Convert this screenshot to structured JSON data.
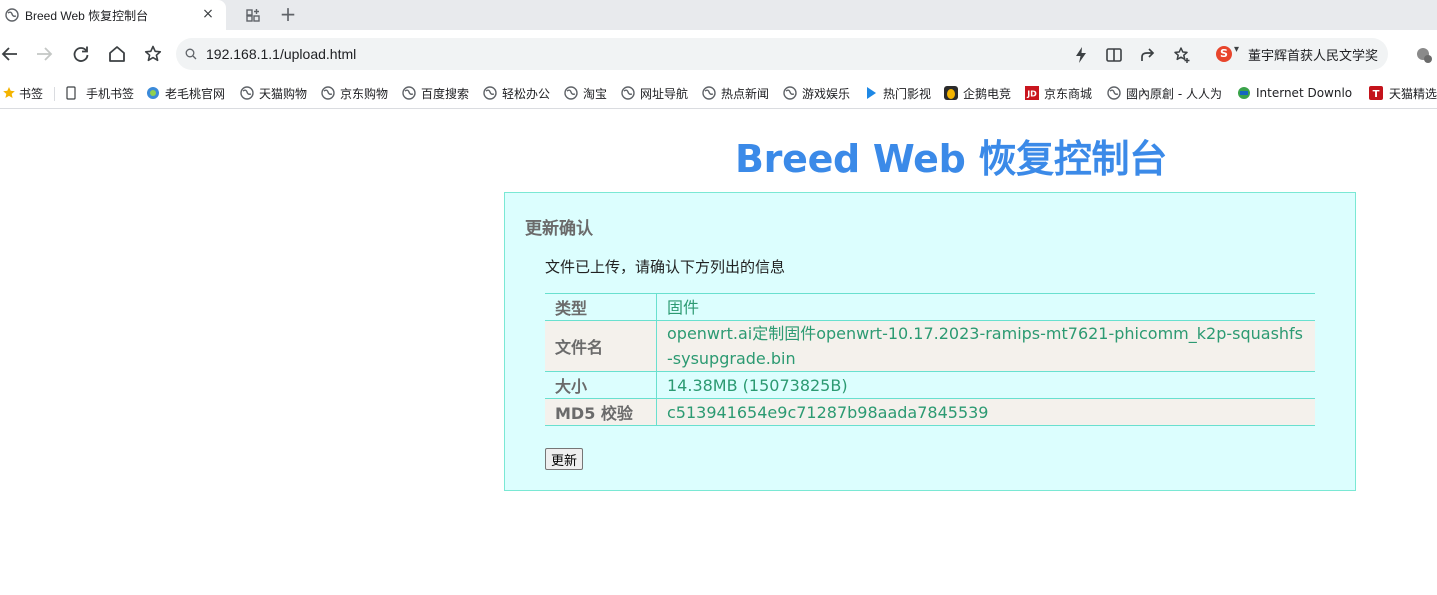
{
  "tab": {
    "title": "Breed Web 恢复控制台",
    "close": "×",
    "new": "+"
  },
  "address": {
    "url": "192.168.1.1/upload.html"
  },
  "extension": {
    "badge": "S",
    "news": "董宇辉首获人民文学奖"
  },
  "bookmarks": [
    {
      "label": "书签",
      "icon": "star-icon"
    },
    {
      "label": "手机书签",
      "icon": "phone-icon"
    },
    {
      "label": "老毛桃官网",
      "icon": "globe-icon"
    },
    {
      "label": "天猫购物",
      "icon": "globe-icon"
    },
    {
      "label": "京东购物",
      "icon": "globe-icon"
    },
    {
      "label": "百度搜索",
      "icon": "globe-icon"
    },
    {
      "label": "轻松办公",
      "icon": "globe-icon"
    },
    {
      "label": "淘宝",
      "icon": "globe-icon"
    },
    {
      "label": "网址导航",
      "icon": "globe-icon"
    },
    {
      "label": "热点新闻",
      "icon": "globe-icon"
    },
    {
      "label": "游戏娱乐",
      "icon": "globe-icon"
    },
    {
      "label": "热门影视",
      "icon": "play-icon"
    },
    {
      "label": "企鹅电竞",
      "icon": "penguin-icon"
    },
    {
      "label": "京东商城",
      "icon": "jd-icon"
    },
    {
      "label": "國內原創 - 人人为",
      "icon": "globe-icon"
    },
    {
      "label": "Internet Downlo",
      "icon": "idm-icon"
    },
    {
      "label": "天猫精选",
      "icon": "tmall-icon"
    }
  ],
  "page": {
    "title": "Breed Web 恢复控制台",
    "heading": "更新确认",
    "description": "文件已上传，请确认下方列出的信息",
    "rows": [
      {
        "key": "类型",
        "value": "固件"
      },
      {
        "key": "文件名",
        "value": "openwrt.ai定制固件openwrt-10.17.2023-ramips-mt7621-phicomm_k2p-squashfs-sysupgrade.bin"
      },
      {
        "key": "大小",
        "value": "14.38MB (15073825B)"
      },
      {
        "key": "MD5 校验",
        "value": "c513941654e9c71287b98aada7845539"
      }
    ],
    "button": "更新"
  },
  "colors": {
    "title": "#3b8ae8",
    "panel_bg": "#dcfefe",
    "panel_border": "#7ae8d4",
    "value_text": "#2c9a72",
    "alt_row": "#f4f1ec"
  }
}
